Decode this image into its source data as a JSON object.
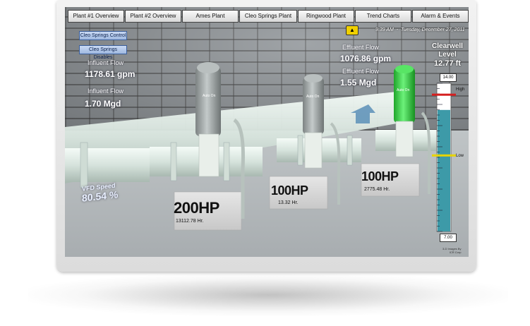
{
  "nav": {
    "tabs": [
      "Plant #1 Overview",
      "Plant #2 Overview",
      "Ames Plant",
      "Cleo Springs Plant",
      "Ringwood Plant",
      "Trend Charts",
      "Alarm & Events"
    ]
  },
  "side_buttons": {
    "control": "Cleo Springs Control",
    "disables": "Cleo Springs Disables"
  },
  "status": {
    "time": "9:39 AM",
    "date": "Tuesday, December 27, 2011"
  },
  "influent": {
    "flow_label": "Influent Flow",
    "flow_gpm": "1178.61 gpm",
    "flow_label2": "Influent Flow",
    "flow_mgd": "1.70 Mgd"
  },
  "effluent": {
    "flow_label": "Effluent Flow",
    "flow_gpm": "1076.86 gpm",
    "flow_label2": "Effluent Flow",
    "flow_mgd": "1.55 Mgd"
  },
  "clearwell": {
    "title_line1": "Clearwell",
    "title_line2": "Level",
    "level": "12.77 ft",
    "max": "14.00",
    "min": "7.00",
    "high_label": "High",
    "low_label": "Low",
    "level_fraction": 0.82,
    "high_fraction": 0.93,
    "low_fraction": 0.52
  },
  "vfd": {
    "label": "VFD Speed",
    "value": "80.54 %"
  },
  "pumps": [
    {
      "hp": "200HP",
      "hours": "13112.78 Hr.",
      "status": "Auto On",
      "color": "#9aa0a0"
    },
    {
      "hp": "100HP",
      "hours": "13.32 Hr.",
      "status": "Auto On",
      "color": "#9aa0a0"
    },
    {
      "hp": "100HP",
      "hours": "2775.48 Hr.",
      "status": "Auto On",
      "color": "#2fd13a"
    }
  ],
  "footnote": {
    "line1": "3-D Images By",
    "line2": "ICR Corp"
  },
  "colors": {
    "pipe": "#dfe9e3",
    "running_motor": "#2fd13a",
    "tank_fill": "#3d9aa8",
    "high_line": "#d52020",
    "low_line": "#e6d400"
  }
}
